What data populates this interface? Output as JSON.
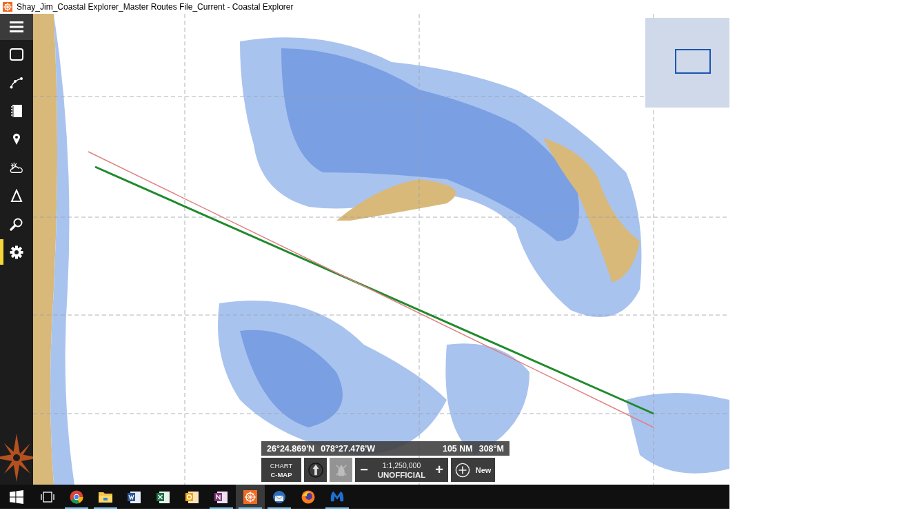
{
  "window": {
    "title": "Shay_Jim_Coastal Explorer_Master Routes File_Current - Coastal Explorer"
  },
  "sidebar": {
    "items": [
      {
        "kind": "menu",
        "selected": false
      },
      {
        "kind": "panes",
        "selected": false
      },
      {
        "kind": "route",
        "selected": false
      },
      {
        "kind": "logbook",
        "selected": false
      },
      {
        "kind": "marker",
        "selected": false
      },
      {
        "kind": "weather",
        "selected": false
      },
      {
        "kind": "tides",
        "selected": false
      },
      {
        "kind": "search",
        "selected": false
      },
      {
        "kind": "settings",
        "selected": true
      }
    ]
  },
  "readout": {
    "latitude": "26°24.869'N",
    "longitude": "078°27.476'W",
    "distance": "105 NM",
    "bearing": "308°M"
  },
  "toolbar": {
    "chart_button": {
      "line1": "CHART",
      "line2": "C-MAP"
    },
    "north_up": {
      "disabled": false
    },
    "boat_follow": {
      "disabled": true
    },
    "zoom": {
      "minus": "−",
      "scale": "1:1,250,000",
      "status": "UNOFFICIAL",
      "plus": "+"
    },
    "new_button": {
      "label": "New"
    }
  },
  "taskbar": {
    "items": [
      {
        "kind": "start",
        "open": false,
        "active": false
      },
      {
        "kind": "taskview",
        "open": false,
        "active": false
      },
      {
        "kind": "chrome",
        "open": true,
        "active": false
      },
      {
        "kind": "explorer",
        "open": true,
        "active": false
      },
      {
        "kind": "word",
        "open": false,
        "active": false
      },
      {
        "kind": "excel",
        "open": false,
        "active": false
      },
      {
        "kind": "outlook",
        "open": false,
        "active": false
      },
      {
        "kind": "onenote",
        "open": true,
        "active": false
      },
      {
        "kind": "coastal",
        "open": true,
        "active": true
      },
      {
        "kind": "thunderbird",
        "open": true,
        "active": false
      },
      {
        "kind": "firefox",
        "open": false,
        "active": false
      },
      {
        "kind": "malwarebytes",
        "open": true,
        "active": false
      }
    ]
  }
}
